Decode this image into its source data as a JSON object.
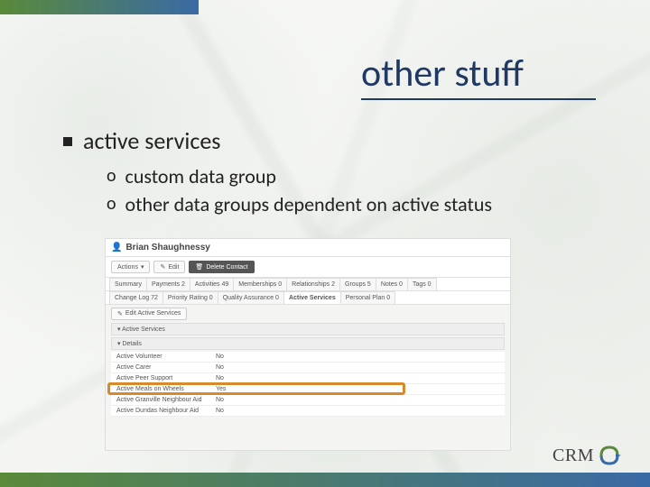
{
  "slide": {
    "title": "other stuff",
    "bullet": "active services",
    "sub_bullets": [
      "custom data group",
      "other data groups dependent on active status"
    ]
  },
  "screenshot": {
    "contact_name": "Brian Shaughnessy",
    "buttons": {
      "actions": "Actions",
      "edit": "Edit",
      "delete": "Delete Contact"
    },
    "tabs_row1": [
      "Summary",
      "Payments 2",
      "Activities 49",
      "Memberships 0",
      "Relationships 2",
      "Groups 5",
      "Notes 0",
      "Tags 0"
    ],
    "tabs_row2": [
      "Change Log 72",
      "Priority Rating 0",
      "Quality Assurance 0",
      "Active Services",
      "Personal Plan 0"
    ],
    "active_tab": "Active Services",
    "panel": {
      "edit_label": "Edit Active Services",
      "section1": "Active Services",
      "section2": "Details",
      "rows": [
        {
          "label": "Active Volunteer",
          "value": "No"
        },
        {
          "label": "Active Carer",
          "value": "No"
        },
        {
          "label": "Active Peer Support",
          "value": "No"
        },
        {
          "label": "Active Meals on Wheels",
          "value": "Yes",
          "highlight": true
        },
        {
          "label": "Active Granville Neighbour Aid",
          "value": "No"
        },
        {
          "label": "Active Dundas Neighbour Aid",
          "value": "No"
        }
      ]
    }
  },
  "branding": {
    "logo_text": "CRM"
  },
  "theme": {
    "stripe_gradient": "linear-gradient(90deg,#5a8a3a 0%,#3a6aa5 100%)",
    "highlight_color": "#d88a2a"
  }
}
